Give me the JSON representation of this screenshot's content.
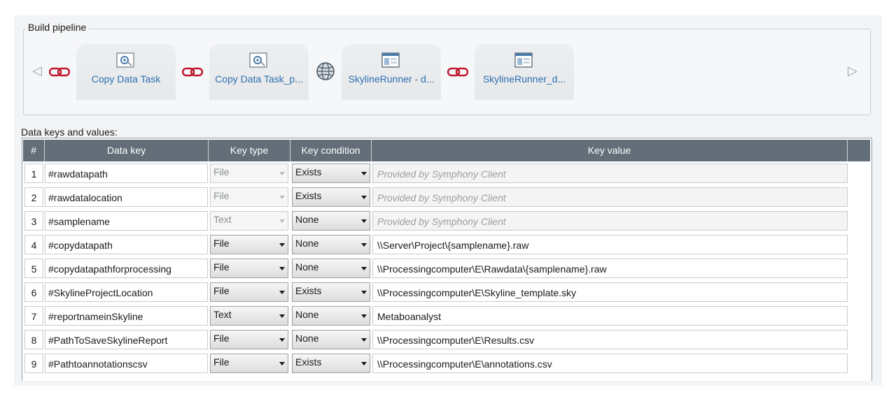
{
  "pipeline": {
    "legend": "Build pipeline",
    "tasks": [
      {
        "label": "Copy Data Task",
        "icon": "gear-task-icon"
      },
      {
        "label": "Copy Data Task_p...",
        "icon": "gear-task-icon"
      },
      {
        "label": "SkylineRunner - d...",
        "icon": "window-task-icon"
      },
      {
        "label": "SkylineRunner_d...",
        "icon": "window-task-icon"
      }
    ],
    "connector_icon": "chain-link-icon",
    "globe_icon": "globe-icon",
    "nav_left": "◁",
    "nav_right": "▷"
  },
  "table": {
    "title": "Data keys and values:",
    "headers": {
      "num": "#",
      "key": "Data key",
      "type": "Key type",
      "condition": "Key condition",
      "value": "Key value"
    },
    "rows": [
      {
        "num": "1",
        "key": "#rawdatapath",
        "type": "File",
        "condition": "Exists",
        "value": "Provided by Symphony Client"
      },
      {
        "num": "2",
        "key": "#rawdatalocation",
        "type": "File",
        "condition": "Exists",
        "value": "Provided by Symphony Client"
      },
      {
        "num": "3",
        "key": "#samplename",
        "type": "Text",
        "condition": "None",
        "value": "Provided by Symphony Client"
      },
      {
        "num": "4",
        "key": "#copydatapath",
        "type": "File",
        "condition": "None",
        "value": "\\\\Server\\Project\\{samplename}.raw"
      },
      {
        "num": "5",
        "key": "#copydatapathforprocessing",
        "type": "File",
        "condition": "None",
        "value": "\\\\Processingcomputer\\E\\Rawdata\\{samplename}.raw"
      },
      {
        "num": "6",
        "key": "#SkylineProjectLocation",
        "type": "File",
        "condition": "Exists",
        "value": "\\\\Processingcomputer\\E\\Skyline_template.sky"
      },
      {
        "num": "7",
        "key": "#reportnameinSkyline",
        "type": "Text",
        "condition": "None",
        "value": "Metaboanalyst"
      },
      {
        "num": "8",
        "key": "#PathToSaveSkylineReport",
        "type": "File",
        "condition": "None",
        "value": "\\\\Processingcomputer\\E\\Results.csv"
      },
      {
        "num": "9",
        "key": "#Pathtoannotationscsv",
        "type": "File",
        "condition": "Exists",
        "value": "\\\\Processingcomputer\\E\\annotations.csv"
      }
    ]
  }
}
